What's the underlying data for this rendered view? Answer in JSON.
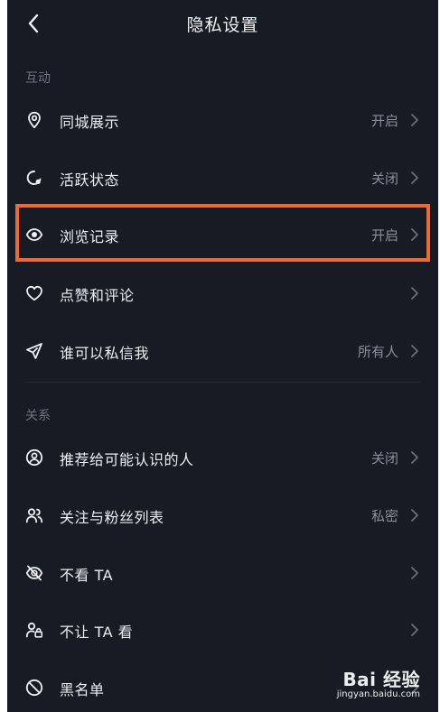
{
  "header": {
    "title": "隐私设置",
    "back_icon": "chevron-left-icon"
  },
  "sections": [
    {
      "title": "互动",
      "items": [
        {
          "label": "同城展示",
          "value": "开启",
          "icon": "location-pin-icon"
        },
        {
          "label": "活跃状态",
          "value": "关闭",
          "icon": "activity-status-icon"
        },
        {
          "label": "浏览记录",
          "value": "开启",
          "icon": "eye-icon",
          "highlighted": true
        },
        {
          "label": "点赞和评论",
          "value": "",
          "icon": "heart-icon"
        },
        {
          "label": "谁可以私信我",
          "value": "所有人",
          "icon": "send-icon"
        }
      ]
    },
    {
      "title": "关系",
      "items": [
        {
          "label": "推荐给可能认识的人",
          "value": "关闭",
          "icon": "user-circle-icon"
        },
        {
          "label": "关注与粉丝列表",
          "value": "私密",
          "icon": "users-icon"
        },
        {
          "label": "不看 TA",
          "value": "",
          "icon": "eye-off-icon"
        },
        {
          "label": "不让 TA 看",
          "value": "",
          "icon": "user-lock-icon"
        },
        {
          "label": "黑名单",
          "value": "",
          "icon": "block-icon"
        }
      ]
    }
  ],
  "watermark": {
    "main": "Bai 经验",
    "sub": "jingyan.baidu.com"
  },
  "colors": {
    "background": "#171b24",
    "text": "#eceef2",
    "secondary_text": "#8a8f9a",
    "highlight": "#ee6a33"
  }
}
